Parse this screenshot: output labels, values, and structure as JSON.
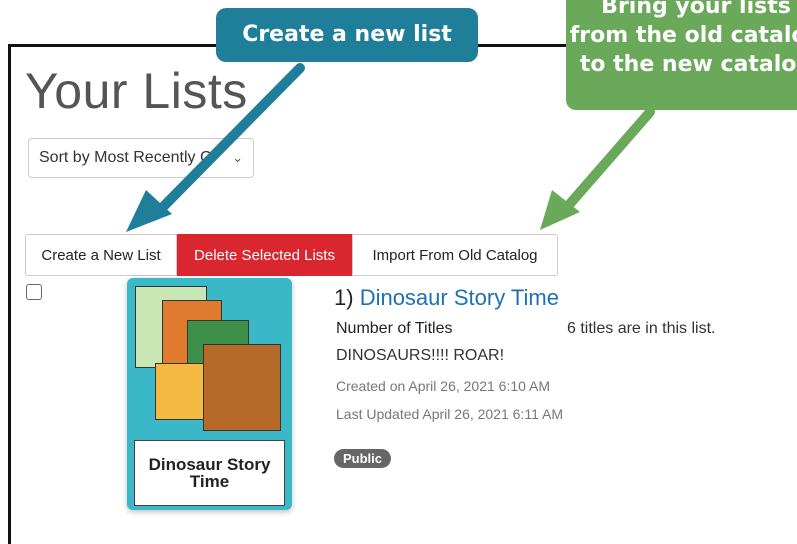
{
  "page": {
    "title": "Your Lists"
  },
  "sort": {
    "selected": "Sort by Most Recently C"
  },
  "buttons": {
    "create": "Create a New List",
    "delete": "Delete Selected Lists",
    "import": "Import From Old Catalog"
  },
  "list_item": {
    "index_label": "1)",
    "title": "Dinosaur Story Time",
    "cover_caption_line1": "Dinosaur Story",
    "cover_caption_line2": "Time",
    "num_titles_label": "Number of Titles",
    "num_titles_value": "6 titles are in this list.",
    "description": "DINOSAURS!!!! ROAR!",
    "created": "Created on April 26, 2021 6:10 AM",
    "updated": "Last Updated April 26, 2021 6:11 AM",
    "visibility_badge": "Public"
  },
  "callouts": {
    "create": "Create a new list",
    "import_line1": "Bring your lists",
    "import_line2": "from the old catalog",
    "import_line3": "to the new catalog"
  },
  "colors": {
    "delete_button": "#d9262f",
    "link": "#1f6fb5",
    "callout_blue": "#1f7f9a",
    "callout_green": "#6aa85a",
    "cover_bg": "#3ab8c8"
  },
  "icons": {
    "select_chevron": "chevron-down-icon"
  }
}
